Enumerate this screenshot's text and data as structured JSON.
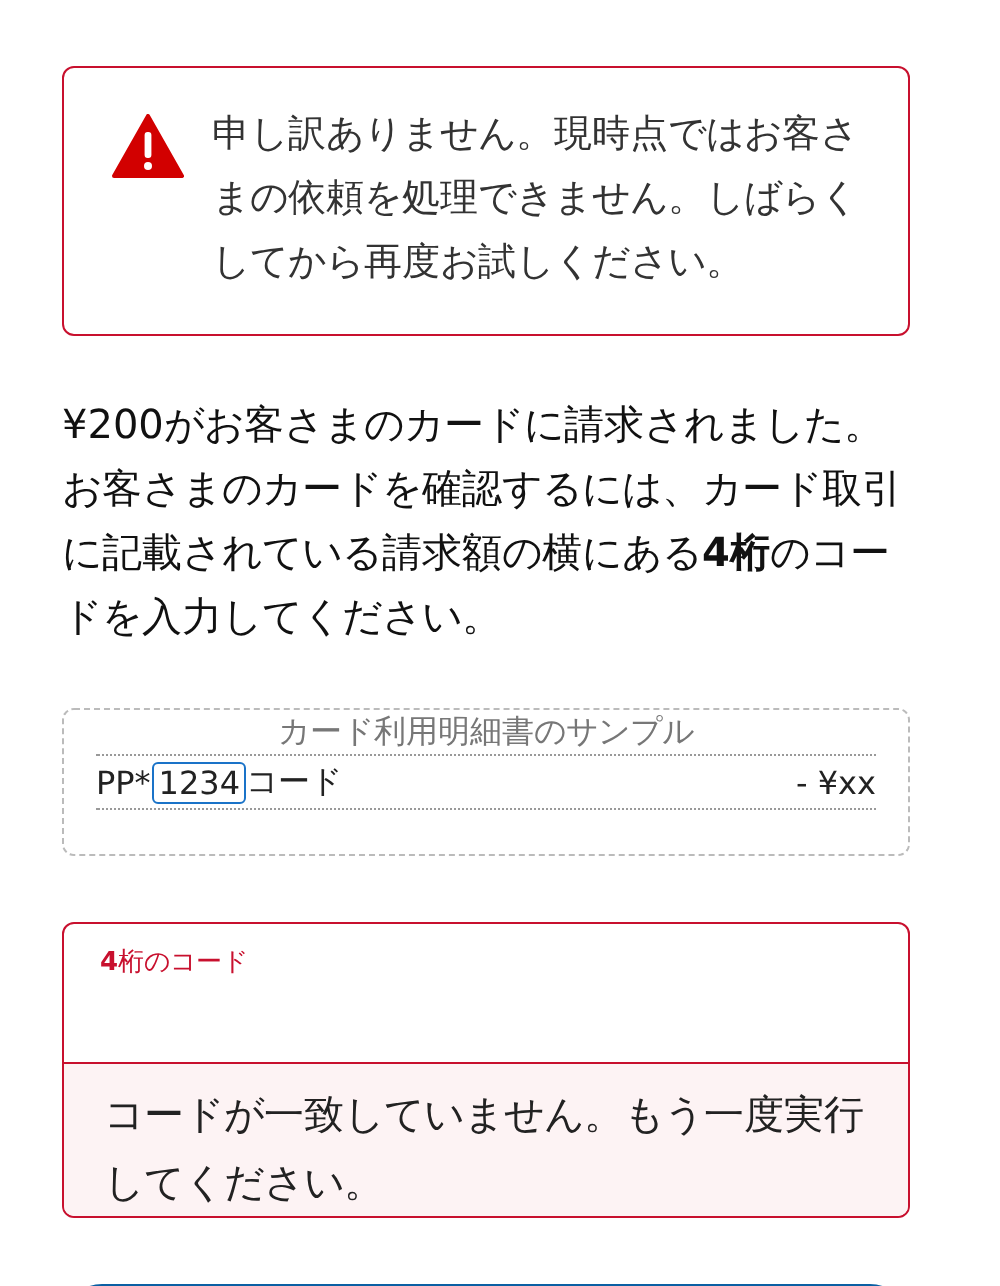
{
  "alert": {
    "kind": "error",
    "message": "申し訳ありません。現時点ではお客さまの依頼を処理できません。しばらくしてから再度お試しください。"
  },
  "instructions": "¥200がお客さまのカードに請求されました。お客さまのカードを確認するには、カード取引に記載されている請求額の横にある**4桁**のコードを入力してください。",
  "sample": {
    "title": "カード利用明細書のサンプル",
    "prefix": "PP*",
    "code": "1234",
    "suffix": "コード",
    "amount": "- ¥xx"
  },
  "code_field": {
    "label": "**4**桁のコード",
    "invalid": true,
    "error": "コードが一致していません。もう一度実行してください。"
  }
}
